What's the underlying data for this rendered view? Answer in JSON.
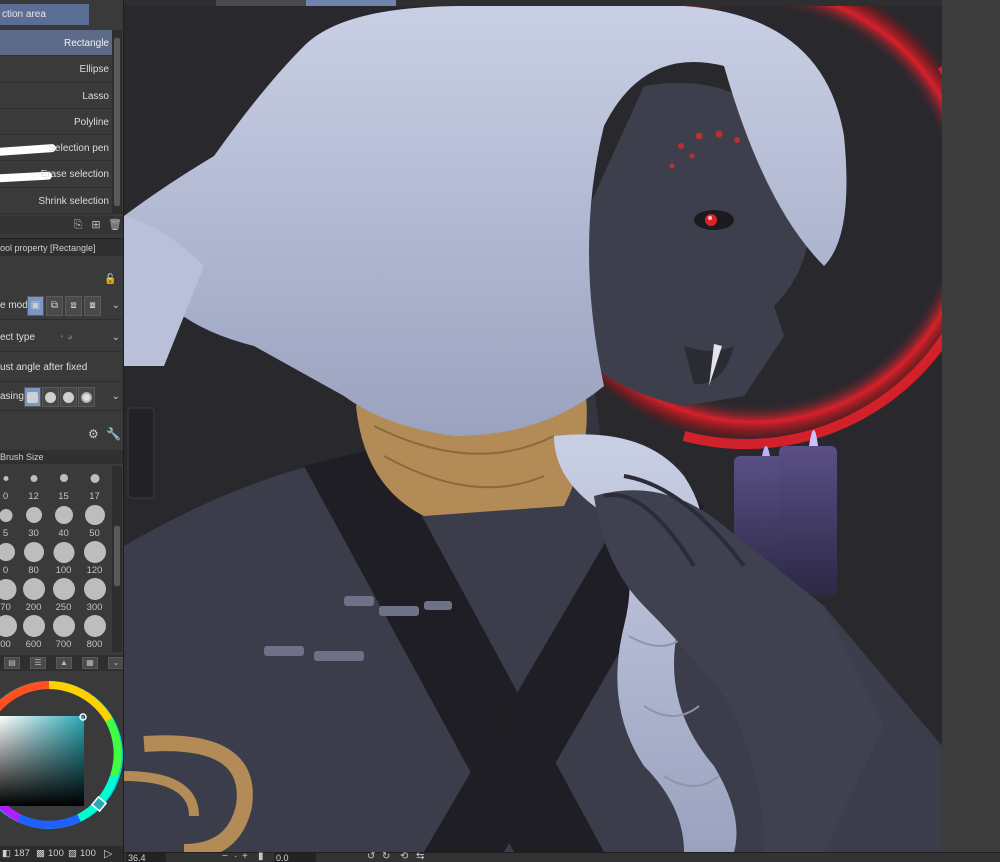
{
  "sub_tool": {
    "header_label": "ction area",
    "items": [
      {
        "label": "Rectangle",
        "selected": true
      },
      {
        "label": "Ellipse"
      },
      {
        "label": "Lasso"
      },
      {
        "label": "Polyline"
      },
      {
        "label": "Selection pen"
      },
      {
        "label": "Erase selection"
      },
      {
        "label": "Shrink selection"
      }
    ],
    "footer_icons": [
      "duplicate-icon",
      "new-icon",
      "trash-icon"
    ]
  },
  "tool_property": {
    "header": "ool property [Rectangle]",
    "lock_icon": "lock-icon",
    "selection_mode_label": "e mode",
    "object_type_label": "ect type",
    "adjust_angle_label": "ust angle after fixed",
    "antialiasing_label": "asing",
    "footer_icons": [
      "wrench-icon",
      "settings-icon"
    ]
  },
  "brush_size": {
    "header": "Brush Size",
    "values": [
      "0",
      "12",
      "15",
      "17",
      "5",
      "30",
      "40",
      "50",
      "0",
      "80",
      "100",
      "120",
      "70",
      "200",
      "250",
      "300",
      "00",
      "600",
      "700",
      "800"
    ]
  },
  "color": {
    "main": "#29a9b6",
    "status_values": [
      "187",
      "100",
      "100"
    ]
  },
  "status_bar": {
    "zoom": "36.4",
    "angle": "0.0"
  },
  "colors": {
    "panel_bg": "#3a3a3a",
    "accent_blue": "#5b6f96",
    "selected_item": "#5d6a88",
    "moon_red": "#e3202a",
    "hair": "#b9c0d8",
    "skin": "#3d3f4d",
    "gold": "#b38b57"
  }
}
